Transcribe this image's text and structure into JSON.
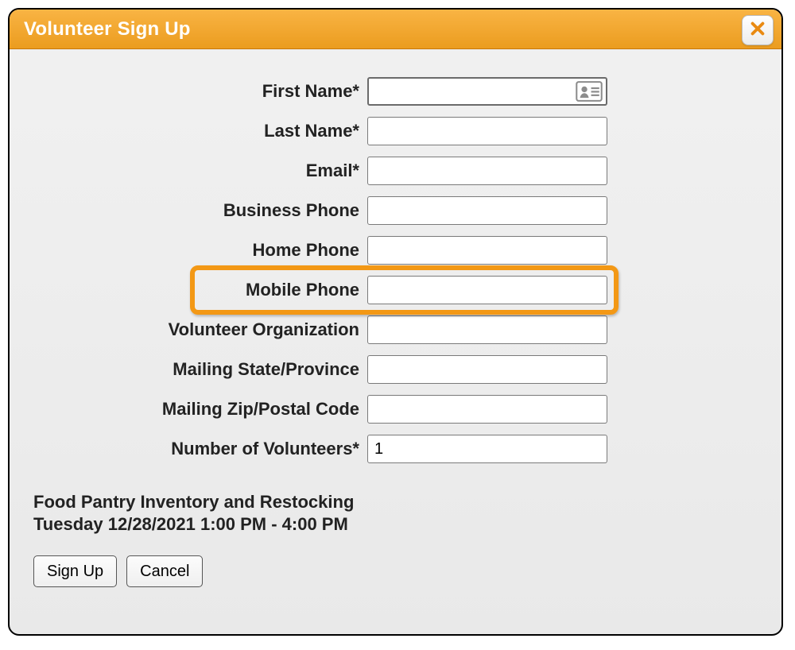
{
  "modal": {
    "title": "Volunteer Sign Up"
  },
  "form": {
    "firstName": {
      "label": "First Name*",
      "value": ""
    },
    "lastName": {
      "label": "Last Name*",
      "value": ""
    },
    "email": {
      "label": "Email*",
      "value": ""
    },
    "businessPhone": {
      "label": "Business Phone",
      "value": ""
    },
    "homePhone": {
      "label": "Home Phone",
      "value": ""
    },
    "mobilePhone": {
      "label": "Mobile Phone",
      "value": ""
    },
    "volunteerOrg": {
      "label": "Volunteer Organization",
      "value": ""
    },
    "mailingState": {
      "label": "Mailing State/Province",
      "value": ""
    },
    "mailingZip": {
      "label": "Mailing Zip/Postal Code",
      "value": ""
    },
    "numVolunteers": {
      "label": "Number of Volunteers*",
      "value": "1"
    }
  },
  "event": {
    "title": "Food Pantry Inventory and Restocking",
    "time": "Tuesday 12/28/2021 1:00 PM - 4:00 PM"
  },
  "buttons": {
    "signUp": "Sign Up",
    "cancel": "Cancel"
  },
  "highlight": {
    "field": "mobilePhone"
  },
  "colors": {
    "accent": "#f39815",
    "headerTop": "#f9b444",
    "headerBottom": "#eb9c1f"
  }
}
